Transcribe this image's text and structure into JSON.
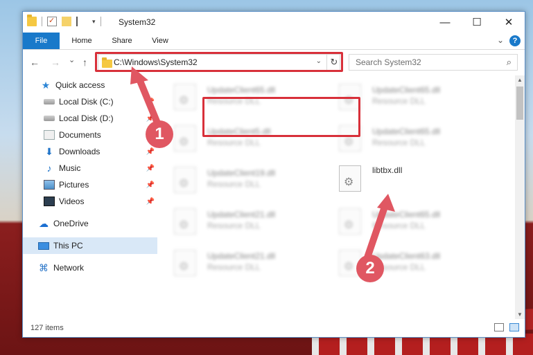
{
  "window": {
    "title": "System32",
    "controls": {
      "minimize": "—",
      "maximize": "☐",
      "close": "✕"
    }
  },
  "ribbon": {
    "tabs": [
      {
        "label": "File",
        "active": true
      },
      {
        "label": "Home"
      },
      {
        "label": "Share"
      },
      {
        "label": "View"
      }
    ],
    "help_label": "?"
  },
  "navigation": {
    "back": "←",
    "forward": "→",
    "recent": "⌄",
    "up": "↑",
    "address": "C:\\Windows\\System32",
    "refresh": "↻",
    "search_placeholder": "Search System32",
    "search_icon": "⌕"
  },
  "sidebar": {
    "items": [
      {
        "label": "Quick access",
        "icon": "star-icon",
        "glyph": "★"
      },
      {
        "label": "Local Disk (C:)",
        "icon": "drive-icon",
        "pinned": true
      },
      {
        "label": "Local Disk (D:)",
        "icon": "drive-icon",
        "pinned": true
      },
      {
        "label": "Documents",
        "icon": "documents-icon",
        "pinned": true
      },
      {
        "label": "Downloads",
        "icon": "downloads-icon",
        "glyph": "⬇",
        "pinned": true
      },
      {
        "label": "Music",
        "icon": "music-icon",
        "glyph": "♪",
        "pinned": true
      },
      {
        "label": "Pictures",
        "icon": "pictures-icon",
        "pinned": true
      },
      {
        "label": "Videos",
        "icon": "videos-icon",
        "pinned": true
      },
      {
        "label": "OneDrive",
        "icon": "onedrive-icon",
        "glyph": "☁"
      },
      {
        "label": "This PC",
        "icon": "computer-icon",
        "selected": true
      },
      {
        "label": "Network",
        "icon": "network-icon",
        "glyph": "⌘"
      }
    ],
    "pin_glyph": "📌"
  },
  "files": [
    {
      "name": "UpdateClient65.dll",
      "desc": "Resource DLL",
      "blurred": true
    },
    {
      "name": "UpdateClient65.dll",
      "desc": "Resource DLL",
      "blurred": true
    },
    {
      "name": "UpdateClient5.dll",
      "desc": "Resource DLL",
      "blurred": true
    },
    {
      "name": "UpdateClient65.dll",
      "desc": "Resource DLL",
      "blurred": true
    },
    {
      "name": "UpdateClient19.dll",
      "desc": "Resource DLL",
      "blurred": true
    },
    {
      "name": "libtbx.dll",
      "desc": "",
      "blurred": false,
      "highlighted": true
    },
    {
      "name": "UpdateClient21.dll",
      "desc": "Resource DLL",
      "blurred": true
    },
    {
      "name": "UpdateClient65.dll",
      "desc": "Resource DLL",
      "blurred": true
    },
    {
      "name": "UpdateClient21.dll",
      "desc": "Resource DLL",
      "blurred": true
    },
    {
      "name": "UpdateClient63.dll",
      "desc": "Resource DLL",
      "blurred": true
    }
  ],
  "status": {
    "item_count": "127 items"
  },
  "annotations": {
    "step1": "1",
    "step2": "2",
    "color": "#e05762",
    "highlight_color": "#d8303a"
  }
}
